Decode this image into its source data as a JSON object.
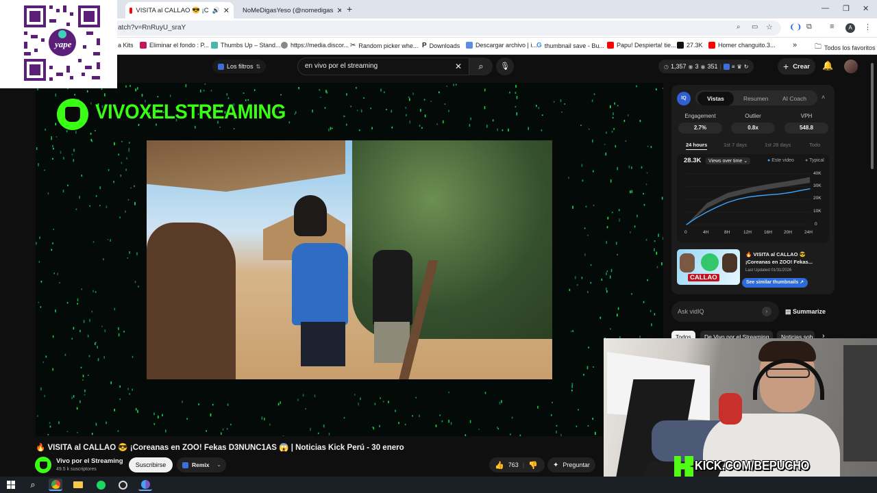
{
  "browser": {
    "tabs": [
      {
        "title": "VISITA al CALLAO 😎 ¡C",
        "icon": "youtube-icon",
        "audio": true
      },
      {
        "title": "NoMeDigasYeso (@nomedigas",
        "icon": "tiktok-icon"
      }
    ],
    "address": "atch?v=RnRuyU_sraY",
    "profile_initial": "A",
    "bookmarks": [
      {
        "label": "a Kits",
        "icon": "bookmark-icon"
      },
      {
        "label": "Eliminar el fondo : P...",
        "icon": "remove-bg-icon"
      },
      {
        "label": "Thumbs Up – Stand...",
        "icon": "thumbs-icon"
      },
      {
        "label": "https://media.discor...",
        "icon": "discord-icon"
      },
      {
        "label": "Random picker whe...",
        "icon": "wheel-icon"
      },
      {
        "label": "Downloads",
        "icon": "p-icon"
      },
      {
        "label": "Descargar archivo | i...",
        "icon": "download-icon"
      },
      {
        "label": "thumbnail save - Bu...",
        "icon": "google-icon"
      },
      {
        "label": "Papu! Despierta! tie...",
        "icon": "youtube-icon"
      },
      {
        "label": "27.3K",
        "icon": "tiktok-icon"
      },
      {
        "label": "Homer changuito.3...",
        "icon": "youtube-icon"
      }
    ],
    "all_bookmarks": "Todos los favoritos"
  },
  "qr": {
    "brand": "yape"
  },
  "youtube": {
    "filters_label": "Los filtros",
    "search_value": "en vivo por el streaming",
    "stats": {
      "a": "1,357",
      "b": "3",
      "c": "351"
    },
    "create_label": "Crear",
    "video": {
      "overlay_brand": "VIVOXELSTREAMING",
      "title": "🔥 VISITA al CALLAO 😎 ¡Coreanas en ZOO! Fekas D3NUNC1AS 😱 | Noticias Kick Perú - 30 enero",
      "channel": "Vivo por el Streaming",
      "subscribers": "49.5 k suscriptores",
      "subscribe_label": "Suscribirse",
      "remix_label": "Remix",
      "likes": "763",
      "ask_label": "Preguntar"
    },
    "chips": [
      "Todos",
      "De Vivo por el Streaming",
      "Noticias sob"
    ]
  },
  "vidiq": {
    "logo": "IQ",
    "tabs": [
      "Vistas",
      "Resumen",
      "AI Coach"
    ],
    "metrics": [
      {
        "label": "Engagement",
        "value": "2.7%"
      },
      {
        "label": "Outlier",
        "value": "0.8x"
      },
      {
        "label": "VPH",
        "value": "548.8"
      }
    ],
    "ranges": [
      "24 hours",
      "1st 7 days",
      "1st 28 days",
      "Todo"
    ],
    "views_total": "28.3K",
    "views_select": "Views over time",
    "legend": [
      "Este video",
      "Typical"
    ],
    "thumb_text": "CALLAO",
    "similar_title": "🔥 VISITA al CALLAO 😎 ¡Coreanas en ZOO! Fekas...",
    "last_updated": "Last Updated 01/31/2026",
    "similar_button": "See similar thumbnails",
    "ask_placeholder": "Ask vidIQ",
    "summarize_label": "Summarize"
  },
  "webcam": {
    "overlay": "KICK.COM/BEPUCHO"
  },
  "chart_data": {
    "type": "line",
    "x_categories": [
      "0",
      "4H",
      "8H",
      "12H",
      "16H",
      "20H",
      "24H"
    ],
    "y_ticks": [
      "40K",
      "30K",
      "20K",
      "10K",
      "0"
    ],
    "ylim": [
      0,
      40000
    ],
    "series": [
      {
        "name": "Este video",
        "x": [
          0,
          2,
          4,
          6,
          8,
          10,
          12,
          14,
          16,
          18,
          20,
          22,
          24
        ],
        "values": [
          0,
          5500,
          10000,
          14000,
          17500,
          20000,
          21700,
          22700,
          23500,
          24100,
          25200,
          26800,
          28300
        ]
      },
      {
        "name": "Typical",
        "x": [
          0,
          4,
          8,
          12,
          16,
          20,
          24
        ],
        "band_low": [
          0,
          13000,
          21000,
          25000,
          28000,
          30500,
          33000
        ],
        "band_high": [
          0,
          17000,
          25000,
          29000,
          32000,
          34500,
          37500
        ]
      }
    ],
    "colors": {
      "este": "#3ea6ff",
      "typical": "#555555"
    }
  }
}
